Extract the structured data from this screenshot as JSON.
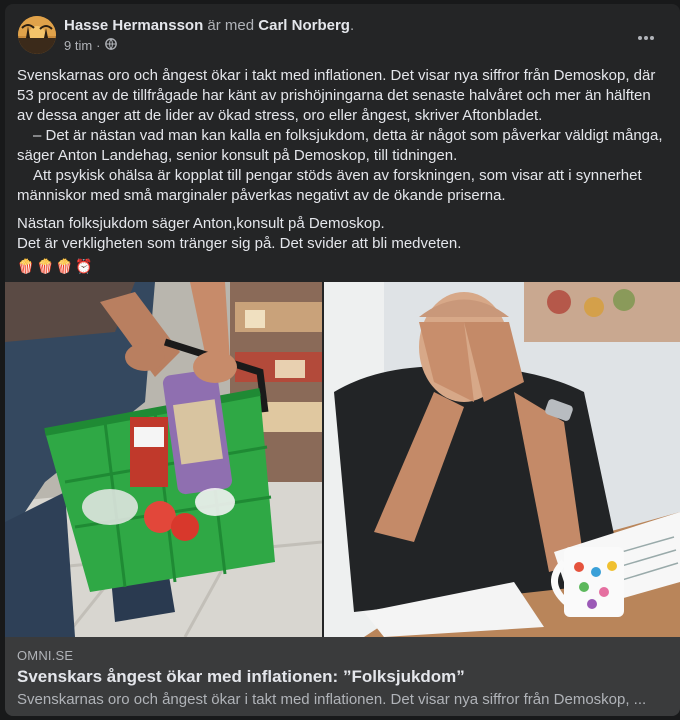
{
  "post": {
    "author": "Hasse Hermansson",
    "with_text": "är med",
    "tagged": "Carl Norberg",
    "tagged_suffix": ".",
    "time": "9 tim",
    "time_sep": "·",
    "privacy_icon": "globe-icon",
    "more_icon": "more-options-icon",
    "paragraphs": [
      "Svenskarnas oro och ångest ökar i takt med inflationen. Det visar nya siffror från Demoskop, där 53 procent av de tillfrågade har känt av prishöjningarna det senaste halvåret och mer än hälften av dessa anger att de lider av ökad stress, oro eller ångest, skriver Aftonbladet.",
      "– Det är nästan vad man kan kalla en folksjukdom, detta är något som påverkar väldigt många, säger Anton Landehag, senior konsult på Demoskop, till tidningen.",
      "Att psykisk ohälsa är kopplat till pengar stöds även av forskningen, som visar att i synnerhet människor med små marginaler påverkas negativt av de ökande priserna.",
      "Nästan folksjukdom säger Anton,konsult på Demoskop.",
      "Det är verkligheten som tränger sig på. Det svider att bli medveten."
    ],
    "emojis": [
      "🍿",
      "🍿",
      "🍿",
      "⏰"
    ]
  },
  "link": {
    "domain": "OMNI.SE",
    "title": "Svenskars ångest ökar med inflationen: ”Folksjukdom”",
    "description": "Svenskarnas oro och ångest ökar i takt med inflationen. Det visar nya siffror från Demoskop, ..."
  },
  "colors": {
    "page_bg": "#18191a",
    "card_bg": "#242526",
    "link_bg": "#3a3b3c",
    "primary_text": "#e4e6eb",
    "secondary_text": "#b0b3b8"
  }
}
